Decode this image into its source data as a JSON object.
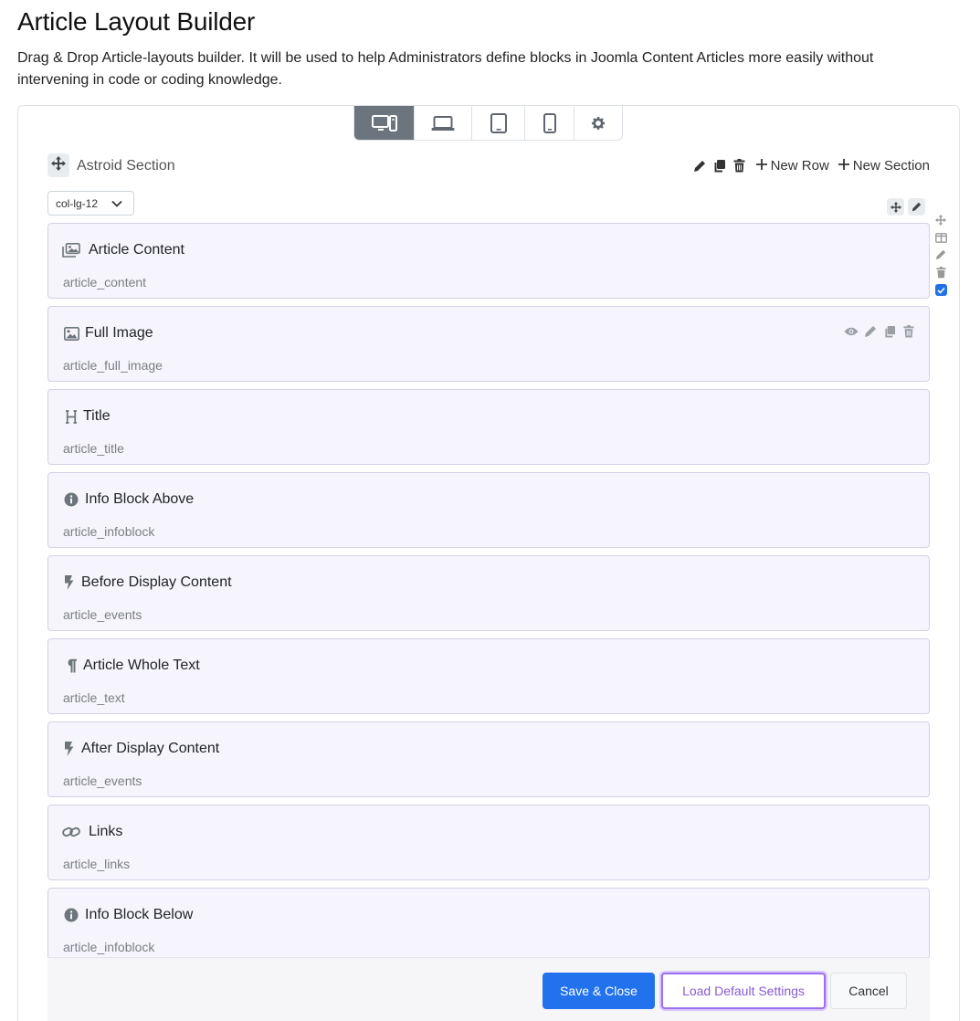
{
  "header": {
    "title": "Article Layout Builder",
    "description": "Drag & Drop Article-layouts builder. It will be used to help Administrators define blocks in Joomla Content Articles more easily without intervening in code or coding knowledge."
  },
  "device_bar": {
    "active": "desktop",
    "items": [
      "desktop-icon",
      "laptop-icon",
      "tablet-icon",
      "mobile-icon",
      "gear-icon"
    ]
  },
  "section": {
    "name": "Astroid Section",
    "new_row_label": "New Row",
    "new_section_label": "New Section"
  },
  "column": {
    "size": "col-lg-12"
  },
  "elements": [
    {
      "title": "Article Content",
      "key": "article_content",
      "icon": "images-icon"
    },
    {
      "title": "Full Image",
      "key": "article_full_image",
      "icon": "image-icon"
    },
    {
      "title": "Title",
      "key": "article_title",
      "icon": "heading-icon"
    },
    {
      "title": "Info Block Above",
      "key": "article_infoblock",
      "icon": "info-icon"
    },
    {
      "title": "Before Display Content",
      "key": "article_events",
      "icon": "bolt-icon"
    },
    {
      "title": "Article Whole Text",
      "key": "article_text",
      "icon": "paragraph-icon"
    },
    {
      "title": "After Display Content",
      "key": "article_events",
      "icon": "bolt-icon"
    },
    {
      "title": "Links",
      "key": "article_links",
      "icon": "link-icon"
    },
    {
      "title": "Info Block Below",
      "key": "article_infoblock",
      "icon": "info-icon"
    }
  ],
  "footer": {
    "save_label": "Save & Close",
    "load_label": "Load Default Settings",
    "cancel_label": "Cancel"
  },
  "colors": {
    "primary": "#2372ed",
    "accent": "#9b6ff0",
    "element_bg": "#f6f4fc"
  }
}
